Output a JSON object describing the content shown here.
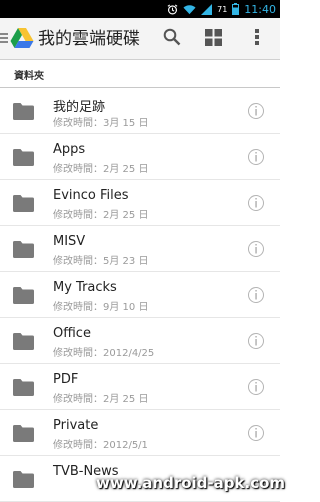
{
  "status_bar": {
    "battery_level": "71",
    "time": "11:40"
  },
  "app_bar": {
    "title": "我的雲端硬碟",
    "actions": [
      "search-icon",
      "grid-view-icon",
      "overflow-menu-icon"
    ]
  },
  "section": {
    "label": "資料夾"
  },
  "folders": [
    {
      "name": "我的足跡",
      "meta": "修改時間：3月 15 日"
    },
    {
      "name": "Apps",
      "meta": "修改時間：2月 25 日"
    },
    {
      "name": "Evinco Files",
      "meta": "修改時間：2月 25 日"
    },
    {
      "name": "MISV",
      "meta": "修改時間：5月 23 日"
    },
    {
      "name": "My Tracks",
      "meta": "修改時間：9月 10 日"
    },
    {
      "name": "Office",
      "meta": "修改時間：2012/4/25"
    },
    {
      "name": "PDF",
      "meta": "修改時間：2月 25 日"
    },
    {
      "name": "Private",
      "meta": "修改時間：2012/5/1"
    },
    {
      "name": "TVB-News",
      "meta": ""
    }
  ],
  "watermark": "www.android-apk.com",
  "colors": {
    "folder": "#7a7a7a",
    "status_icons": "#33b5e5",
    "app_bar": "#f4f4f4"
  }
}
